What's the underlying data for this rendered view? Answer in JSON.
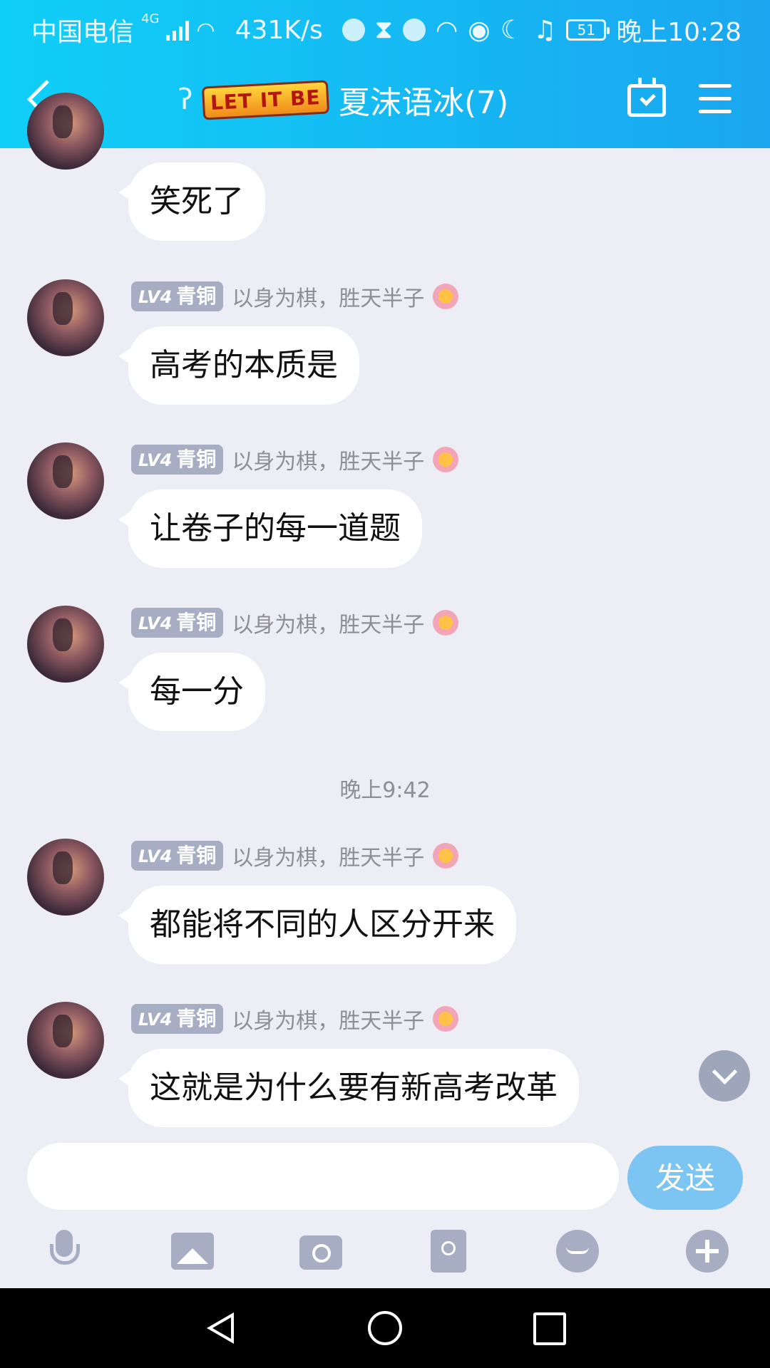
{
  "status_bar": {
    "carrier": "中国电信",
    "network": "4G",
    "speed": "431K/s",
    "battery": "51",
    "time": "晚上10:28"
  },
  "header": {
    "title": "夏沫语冰(7)",
    "logo_text": "LET IT BE",
    "icons": [
      "back-icon",
      "hearing-icon",
      "calendar-check-icon",
      "menu-icon"
    ]
  },
  "messages": [
    {
      "has_meta": false,
      "text": "笑死了"
    },
    {
      "has_meta": true,
      "level": "LV4",
      "rank": "青铜",
      "nickname": "以身为棋，胜天半子",
      "text": "高考的本质是"
    },
    {
      "has_meta": true,
      "level": "LV4",
      "rank": "青铜",
      "nickname": "以身为棋，胜天半子",
      "text": "让卷子的每一道题"
    },
    {
      "has_meta": true,
      "level": "LV4",
      "rank": "青铜",
      "nickname": "以身为棋，胜天半子",
      "text": "每一分"
    },
    {
      "timestamp": "晚上9:42"
    },
    {
      "has_meta": true,
      "level": "LV4",
      "rank": "青铜",
      "nickname": "以身为棋，胜天半子",
      "text": "都能将不同的人区分开来"
    },
    {
      "has_meta": true,
      "level": "LV4",
      "rank": "青铜",
      "nickname": "以身为棋，胜天半子",
      "text": "这就是为什么要有新高考改革"
    }
  ],
  "input": {
    "value": "",
    "placeholder": "",
    "send_label": "发送"
  },
  "toolbar": {
    "icons": [
      "microphone-icon",
      "image-icon",
      "camera-icon",
      "red-packet-icon",
      "emoji-icon",
      "plus-icon"
    ]
  },
  "colors": {
    "header_gradient_start": "#10CFF7",
    "header_gradient_end": "#1AA6F0",
    "background": "#EDEEF5",
    "bubble": "#FFFFFF",
    "badge": "#A7AEC3",
    "send_button": "#7CC4F2"
  }
}
